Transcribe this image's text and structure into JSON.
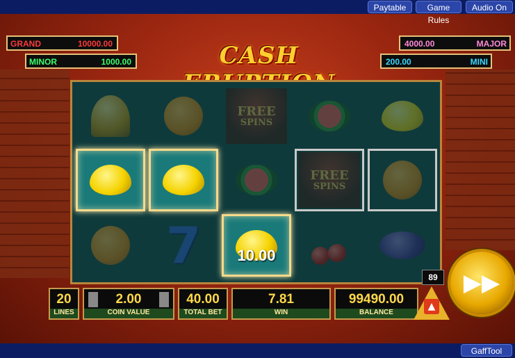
{
  "topbar": {
    "paytable": "Paytable",
    "game_rules": "Game Rules",
    "audio": "Audio On"
  },
  "bottombar": {
    "gafftool": "GaffTool"
  },
  "title": "CASH ERUPTION",
  "jackpots": {
    "grand": {
      "label": "GRAND",
      "value": "10000.00"
    },
    "minor": {
      "label": "MINOR",
      "value": "1000.00"
    },
    "major": {
      "label": "MAJOR",
      "value": "4000.00"
    },
    "mini": {
      "label": "MINI",
      "value": "200.00"
    }
  },
  "reels": {
    "free_spins_top": "FREE",
    "free_spins_bottom": "SPINS",
    "seven": "7",
    "win_value": "10.00"
  },
  "panel": {
    "lines": {
      "value": "20",
      "label": "LINES"
    },
    "coin_value": {
      "value": "2.00",
      "label": "COIN VALUE"
    },
    "total_bet": {
      "value": "40.00",
      "label": "TOTAL BET"
    },
    "win": {
      "value": "7.81",
      "label": "WIN"
    },
    "balance": {
      "value": "99490.00",
      "label": "BALANCE"
    }
  },
  "counter": "89",
  "spin_icon": "fast-forward-icon",
  "colors": {
    "gold": "#ffd84a",
    "panel_green": "#1e4a1e",
    "jackpot_red": "#ff3a3a",
    "jackpot_green": "#3cff6a",
    "jackpot_pink": "#ff8ad8",
    "jackpot_cyan": "#3ad8ff"
  }
}
